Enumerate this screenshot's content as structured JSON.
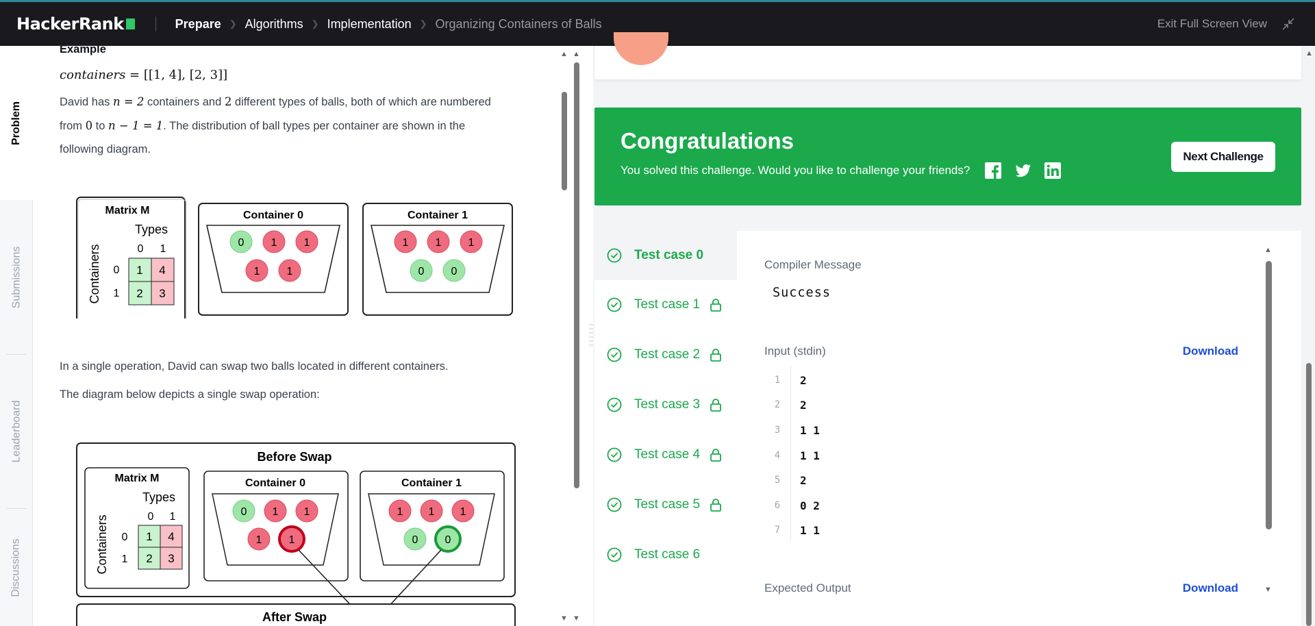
{
  "header": {
    "logo": "HackerRank",
    "breadcrumbs": [
      "Prepare",
      "Algorithms",
      "Implementation",
      "Organizing Containers of Balls"
    ],
    "exit_label": "Exit Full Screen View"
  },
  "sidebar_tabs": [
    "Problem",
    "Submissions",
    "Leaderboard",
    "Discussions"
  ],
  "problem": {
    "heading": "Example",
    "example_var": "containers",
    "example_value": " = [[1, 4], [2, 3]]",
    "para1_a": "David has ",
    "para1_n": "n = 2",
    "para1_b": " containers and ",
    "para1_2": "2",
    "para1_c": " different types of balls, both of which are numbered",
    "para2_a": "from ",
    "para2_0": "0",
    "para2_b": " to ",
    "para2_expr": "n − 1 = 1",
    "para2_c": ". The distribution of ball types per container are shown in the",
    "para3": "following diagram.",
    "op_text": "In a single operation, David can swap two balls located in different containers.",
    "diagram_text": "The diagram below depicts a single swap operation:"
  },
  "diagram1": {
    "matrix_title": "Matrix M",
    "types_label": "Types",
    "containers_label": "Containers",
    "col_headers": [
      "0",
      "1"
    ],
    "row_headers": [
      "0",
      "1"
    ],
    "cells": [
      [
        "1",
        "4"
      ],
      [
        "2",
        "3"
      ]
    ],
    "container0_title": "Container 0",
    "container1_title": "Container 1",
    "container0_balls_top": [
      "0",
      "1",
      "1"
    ],
    "container0_balls_bottom": [
      "1",
      "1"
    ],
    "container1_balls_top": [
      "1",
      "1",
      "1"
    ],
    "container1_balls_bottom": [
      "0",
      "0"
    ]
  },
  "diagram2": {
    "title": "Before Swap",
    "next_title": "After Swap"
  },
  "congrats": {
    "title": "Congratulations",
    "message": "You solved this challenge. Would you like to challenge your friends?",
    "next_button": "Next Challenge"
  },
  "test_cases": [
    {
      "label": "Test case 0",
      "locked": false,
      "active": true
    },
    {
      "label": "Test case 1",
      "locked": true,
      "active": false
    },
    {
      "label": "Test case 2",
      "locked": true,
      "active": false
    },
    {
      "label": "Test case 3",
      "locked": true,
      "active": false
    },
    {
      "label": "Test case 4",
      "locked": true,
      "active": false
    },
    {
      "label": "Test case 5",
      "locked": true,
      "active": false
    },
    {
      "label": "Test case 6",
      "locked": false,
      "active": false
    }
  ],
  "result": {
    "compiler_label": "Compiler Message",
    "compiler_message": "Success",
    "input_label": "Input (stdin)",
    "download_label": "Download",
    "expected_label": "Expected Output",
    "input_lines": [
      {
        "n": "1",
        "v": "2"
      },
      {
        "n": "2",
        "v": "2"
      },
      {
        "n": "3",
        "v": "1 1"
      },
      {
        "n": "4",
        "v": "1 1"
      },
      {
        "n": "5",
        "v": "2"
      },
      {
        "n": "6",
        "v": "0 2"
      },
      {
        "n": "7",
        "v": "1 1"
      }
    ]
  },
  "colors": {
    "green": "#1ba94c",
    "red_ball": "#ef6b7e",
    "green_ball": "#9ee6a8",
    "pink_cell": "#f9c0c8",
    "green_cell": "#c9f2cf"
  }
}
